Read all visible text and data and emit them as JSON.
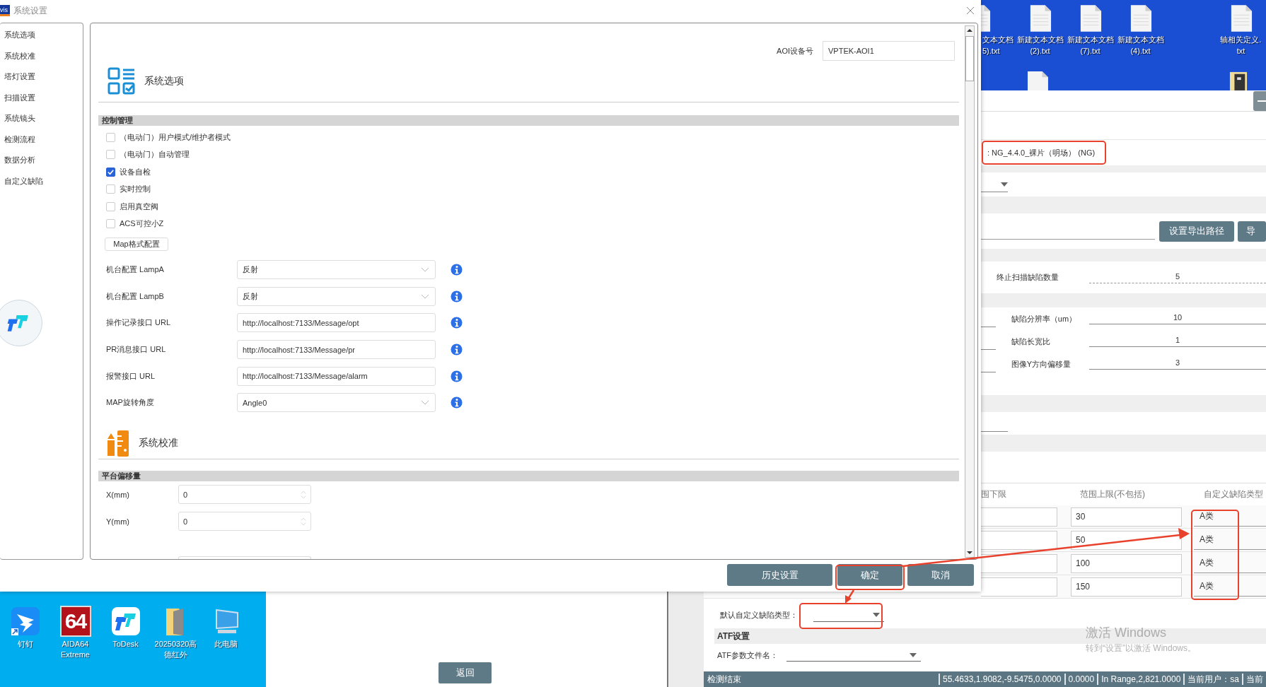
{
  "dialog": {
    "logo": "vis",
    "title": "系统设置",
    "nav": [
      {
        "label": "系统选项"
      },
      {
        "label": "系统校准"
      },
      {
        "label": "塔灯设置"
      },
      {
        "label": "扫描设置"
      },
      {
        "label": "系统镜头"
      },
      {
        "label": "检测流程"
      },
      {
        "label": "数据分析"
      },
      {
        "label": "自定义缺陷"
      }
    ],
    "device": {
      "label": "AOI设备号",
      "value": "VPTEK-AOI1"
    },
    "options": {
      "title": "系统选项",
      "group": "控制管理",
      "checks": [
        {
          "label": "（电动门）用户模式/维护者模式",
          "checked": false
        },
        {
          "label": "（电动门）自动管理",
          "checked": false
        },
        {
          "label": "设备自检",
          "checked": true
        },
        {
          "label": "实时控制",
          "checked": false
        },
        {
          "label": "启用真空阀",
          "checked": false
        },
        {
          "label": "ACS可控小Z",
          "checked": false
        }
      ],
      "map_button": "Map格式配置",
      "fields": [
        {
          "label": "机台配置 LampA",
          "kind": "select",
          "value": "反射"
        },
        {
          "label": "机台配置 LampB",
          "kind": "select",
          "value": "反射"
        },
        {
          "label": "操作记录接口 URL",
          "kind": "text",
          "value": "http://localhost:7133/Message/opt"
        },
        {
          "label": "PR消息接口 URL",
          "kind": "text",
          "value": "http://localhost:7133/Message/pr"
        },
        {
          "label": "报警接口 URL",
          "kind": "text",
          "value": "http://localhost:7133/Message/alarm"
        },
        {
          "label": "MAP旋转角度",
          "kind": "select",
          "value": "Angle0"
        }
      ]
    },
    "calibration": {
      "title": "系统校准",
      "group": "平台偏移量",
      "fields": [
        {
          "label": "X(mm)",
          "value": "0"
        },
        {
          "label": "Y(mm)",
          "value": "0"
        }
      ]
    },
    "buttons": [
      {
        "label": "历史设置"
      },
      {
        "label": "确定"
      },
      {
        "label": "取消"
      }
    ]
  },
  "desktop": {
    "top_icons": [
      {
        "kind": "file",
        "lines": [
          "文本文档",
          "5).txt"
        ]
      },
      {
        "kind": "file",
        "lines": [
          "新建文本文档",
          "(2).txt"
        ]
      },
      {
        "kind": "file",
        "lines": [
          "新建文本文档",
          "(7).txt"
        ]
      },
      {
        "kind": "file",
        "lines": [
          "新建文本文档",
          "(4).txt"
        ]
      },
      {
        "kind": "file",
        "lines": [
          "轴相关定义.",
          "txt"
        ]
      }
    ],
    "bottom_icons": [
      {
        "kind": "dingtalk",
        "label": "钉钉"
      },
      {
        "kind": "aida",
        "label": "AIDA64 Extreme",
        "badge": "64"
      },
      {
        "kind": "todesk",
        "label": "ToDesk"
      },
      {
        "kind": "folder",
        "label": "20250320高德红外"
      },
      {
        "kind": "computer",
        "label": "此电脑"
      }
    ]
  },
  "back_button": "返回",
  "app": {
    "recipe": ": NG_4.4.0_裸片（明场） (NG)",
    "export_buttons": [
      {
        "label": "设置导出路径"
      },
      {
        "label": "导"
      }
    ],
    "stop_param": {
      "label": "终止扫描缺陷数量",
      "value": "5"
    },
    "params": [
      {
        "label": "缺陷分辨率（um）",
        "value": "10"
      },
      {
        "label": "缺陷长宽比",
        "value": "1"
      },
      {
        "label": "图像Y方向偏移量",
        "value": "3"
      }
    ],
    "table": {
      "columns": [
        "围下限",
        "范围上限(不包括)",
        "自定义缺陷类型"
      ],
      "rows": [
        {
          "upper": "30",
          "type": "A类"
        },
        {
          "upper": "50",
          "type": "A类"
        },
        {
          "upper": "100",
          "type": "A类"
        },
        {
          "upper": "150",
          "type": "A类"
        }
      ]
    },
    "default_type": {
      "label": "默认自定义缺陷类型："
    },
    "atf": {
      "title": "ATF设置",
      "file_label": "ATF参数文件名："
    },
    "status": {
      "state": "检测结束",
      "segments": [
        "55.4633,1.9082,-9.5475,0.0000",
        "0.0000",
        "In Range,2,821.0000",
        "当前用户：sa",
        "当前"
      ]
    }
  },
  "activation": {
    "title": "激活 Windows",
    "hint": "转到“设置”以激活 Windows。"
  }
}
